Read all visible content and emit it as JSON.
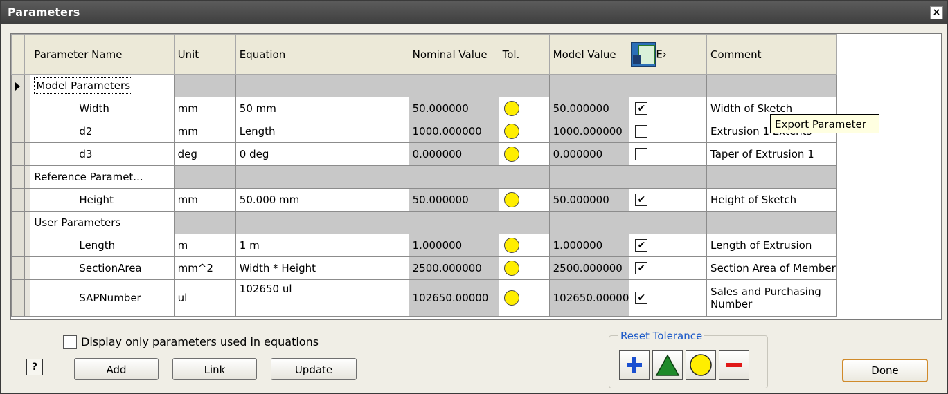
{
  "window": {
    "title": "Parameters",
    "close_symbol": "×"
  },
  "columns": {
    "name": "Parameter Name",
    "unit": "Unit",
    "equation": "Equation",
    "nominal": "Nominal Value",
    "tol": "Tol.",
    "model": "Model Value",
    "export": "E›",
    "comment": "Comment"
  },
  "tooltip": "Export Parameter",
  "groups": [
    {
      "label": "Model Parameters"
    },
    {
      "label": "Reference Paramet..."
    },
    {
      "label": "User Parameters"
    }
  ],
  "rows": [
    {
      "name": "Width",
      "unit": "mm",
      "equation": "50 mm",
      "nominal": "50.000000",
      "model": "50.000000",
      "export": true,
      "comment": "Width of Sketch"
    },
    {
      "name": "d2",
      "unit": "mm",
      "equation": "Length",
      "nominal": "1000.000000",
      "model": "1000.000000",
      "export": false,
      "comment": "Extrusion 1 Extents"
    },
    {
      "name": "d3",
      "unit": "deg",
      "equation": "0 deg",
      "nominal": "0.000000",
      "model": "0.000000",
      "export": false,
      "comment": "Taper of Extrusion 1"
    },
    {
      "name": "Height",
      "unit": "mm",
      "equation": "50.000 mm",
      "nominal": "50.000000",
      "model": "50.000000",
      "export": true,
      "comment": "Height of Sketch"
    },
    {
      "name": "Length",
      "unit": "m",
      "equation": "1 m",
      "nominal": "1.000000",
      "model": "1.000000",
      "export": true,
      "comment": "Length of Extrusion"
    },
    {
      "name": "SectionArea",
      "unit": "mm^2",
      "equation": "Width * Height",
      "nominal": "2500.000000",
      "model": "2500.000000",
      "export": true,
      "comment": "Section Area of Member"
    },
    {
      "name": "SAPNumber",
      "unit": "ul",
      "equation": "102650 ul",
      "nominal": "102650.00000",
      "model": "102650.00000",
      "export": true,
      "comment_line1": "Sales and Purchasing",
      "comment_line2": "Number"
    }
  ],
  "bottom": {
    "display_only_label": "Display only parameters used in equations",
    "help_symbol": "?",
    "add_label": "Add",
    "link_label": "Link",
    "update_label": "Update",
    "reset_tolerance_label": "Reset Tolerance",
    "done_label": "Done",
    "tolerance_buttons": [
      "upper-tolerance-icon",
      "median-tolerance-icon",
      "nominal-tolerance-icon",
      "lower-tolerance-icon"
    ]
  },
  "colors": {
    "tolerance_indicator": "#ffee00",
    "reset_label": "#1a58c8",
    "done_border": "#d08a2a"
  },
  "checkmark": "✔"
}
